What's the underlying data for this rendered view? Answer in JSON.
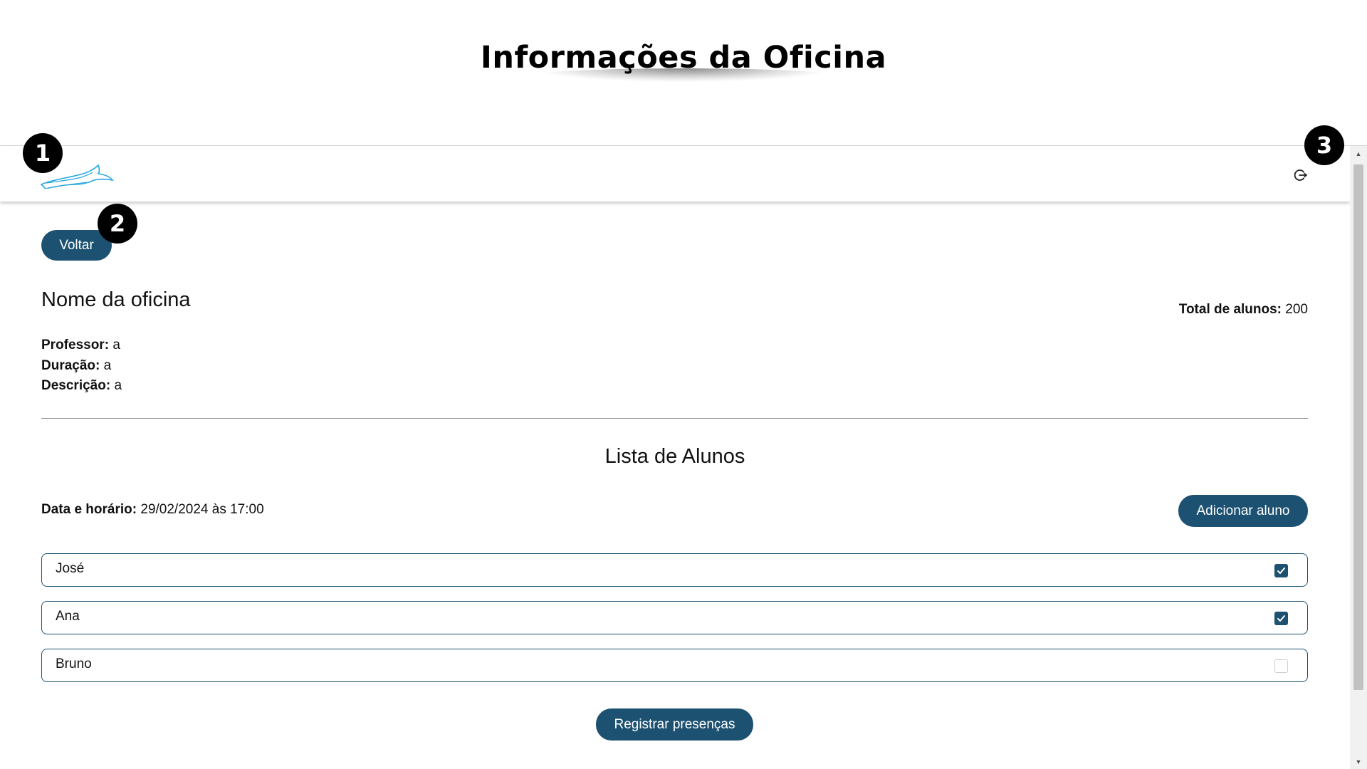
{
  "page_heading": "Informações da Oficina",
  "header": {
    "logo_icon": "seagull-logo-icon",
    "logout_icon": "logout-icon"
  },
  "navigation": {
    "back_label": "Voltar"
  },
  "workshop": {
    "name": "Nome da oficina",
    "total_label": "Total de alunos:",
    "total_value": "200",
    "professor_label": "Professor:",
    "professor_value": "a",
    "duration_label": "Duração:",
    "duration_value": "a",
    "description_label": "Descrição:",
    "description_value": "a"
  },
  "students_list": {
    "title": "Lista de Alunos",
    "date_label": "Data e horário:",
    "date_value": "29/02/2024 às 17:00",
    "add_button_label": "Adicionar aluno",
    "students": [
      {
        "name": "José",
        "present": true
      },
      {
        "name": "Ana",
        "present": true
      },
      {
        "name": "Bruno",
        "present": false
      }
    ],
    "register_button_label": "Registrar presenças"
  },
  "markers": [
    "1",
    "2",
    "3"
  ],
  "colors": {
    "primary": "#1c5171",
    "logo": "#29a8e0",
    "marker": "#000000"
  }
}
